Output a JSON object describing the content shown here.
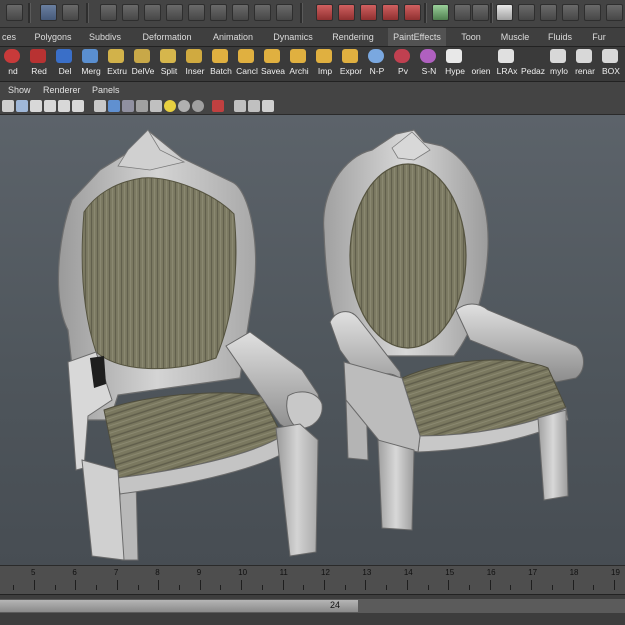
{
  "shelf_tabs": [
    "ces",
    "Polygons",
    "Subdivs",
    "Deformation",
    "Animation",
    "Dynamics",
    "Rendering",
    "PaintEffects",
    "Toon",
    "Muscle",
    "Fluids",
    "Fur"
  ],
  "shelf_items": [
    {
      "label": "nd",
      "icon": "sphere-icon",
      "color": "#c83a3a"
    },
    {
      "label": "Red",
      "icon": "reduce-icon",
      "color": "#b83232"
    },
    {
      "label": "Del",
      "icon": "delete-icon",
      "color": "#3a6fc8"
    },
    {
      "label": "Merg",
      "icon": "merge-icon",
      "color": "#5a8fd0"
    },
    {
      "label": "Extru",
      "icon": "extrude-icon",
      "color": "#d2b24a"
    },
    {
      "label": "DelVe",
      "icon": "delete-vertex-icon",
      "color": "#c8a848"
    },
    {
      "label": "Split",
      "icon": "split-icon",
      "color": "#d6b64c"
    },
    {
      "label": "Inser",
      "icon": "insert-edge-icon",
      "color": "#d0aa40"
    },
    {
      "label": "Batch",
      "icon": "folder-icon",
      "color": "#e0b040"
    },
    {
      "label": "Cancl",
      "icon": "folder-icon",
      "color": "#e0b040"
    },
    {
      "label": "Savea",
      "icon": "folder-icon",
      "color": "#e0b040"
    },
    {
      "label": "Archi",
      "icon": "folder-icon",
      "color": "#e0b040"
    },
    {
      "label": "Imp",
      "icon": "folder-icon",
      "color": "#e0b040"
    },
    {
      "label": "Expor",
      "icon": "folder-icon",
      "color": "#e0b040"
    },
    {
      "label": "N-P",
      "icon": "globe-icon",
      "color": "#7aa8e0"
    },
    {
      "label": "Pv",
      "icon": "globe-icon",
      "color": "#c04050"
    },
    {
      "label": "S-N",
      "icon": "globe-icon",
      "color": "#b060c0"
    },
    {
      "label": "Hype",
      "icon": "window-icon",
      "color": "#e8e8e8"
    },
    {
      "label": "orien",
      "icon": "blank-icon",
      "color": "#3a3a3a"
    },
    {
      "label": "LRAx",
      "icon": "axis-icon",
      "color": "#e0e0e0"
    },
    {
      "label": "Pedaz",
      "icon": "blank-icon",
      "color": "#3a3a3a"
    },
    {
      "label": "mylo",
      "icon": "script-icon",
      "color": "#d8d8d8"
    },
    {
      "label": "renar",
      "icon": "script-icon",
      "color": "#d8d8d8"
    },
    {
      "label": "BOX",
      "icon": "script-icon",
      "color": "#d8d8d8"
    }
  ],
  "panel_menu": [
    "Show",
    "Renderer",
    "Panels"
  ],
  "time_slider": {
    "frames": [
      5,
      6,
      7,
      8,
      9,
      10,
      11,
      12,
      13,
      14,
      15,
      16,
      17,
      18,
      19
    ]
  },
  "range_slider": {
    "end_value": "24"
  },
  "colors": {
    "viewport": "#535a60",
    "chair_frame": "#c9c9c9",
    "fabric": "#7d7b63"
  }
}
